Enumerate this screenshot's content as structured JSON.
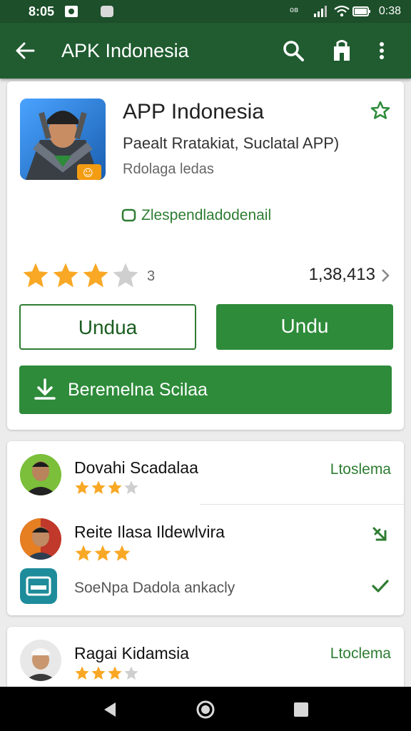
{
  "status": {
    "time": "8:05",
    "right_time": "0:38"
  },
  "appbar": {
    "title": "APK Indonesia"
  },
  "app": {
    "title": "APP Indonesia",
    "subtitle": "Paealt Rratakiat, Suclatal APP)",
    "meta": "Rdolaga ledas",
    "link": "Zlespendladodenail",
    "rating_count": "3",
    "downloads": "1,38,413",
    "rating": 3
  },
  "buttons": {
    "outline": "Undua",
    "filled": "Undu",
    "wide": "Beremelna Scilaa"
  },
  "reviews": [
    {
      "name": "Dovahi Scadalaa",
      "action": "Ltoslema",
      "stars": 3
    },
    {
      "name": "Reite Ilasa Ildewlvira",
      "stars": 3
    },
    {
      "sub": "SoeNpa Dadola ankacly"
    },
    {
      "name": "Ragai Kidamsia",
      "action": "Ltoclema",
      "stars": 3
    }
  ],
  "colors": {
    "primary": "#205c30",
    "accent": "#2e8b3a",
    "star": "#f9a825",
    "star_empty": "#cfcfcf"
  }
}
